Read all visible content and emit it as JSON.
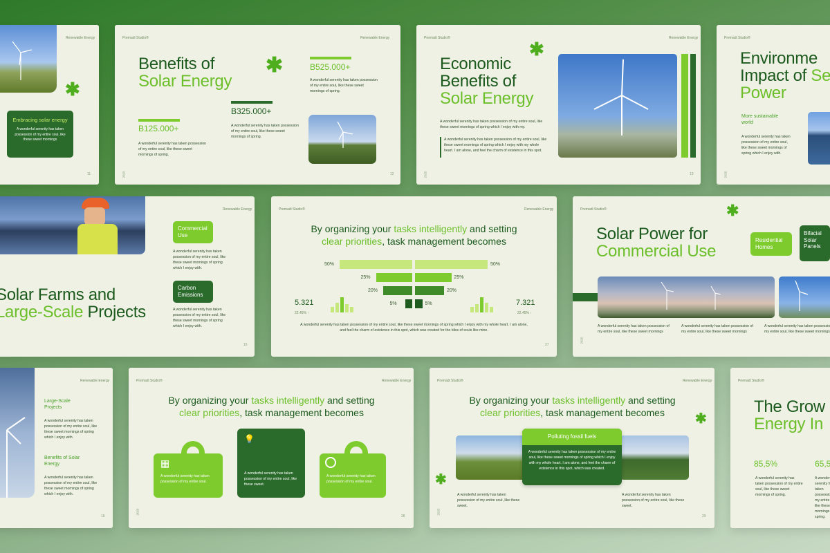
{
  "brand": "Premadi Studio®",
  "category": "Renewable Energy",
  "year": "2025",
  "lorem_short": "A wonderful serenity has taken possession of my entire soul, like these sweet mornings of spring.",
  "s11": {
    "box_title": "Embracing solar energy",
    "box_text": "A wonderful serenity has taken possession of my entire soul, like these sweet mornings",
    "page": "11"
  },
  "s12": {
    "title_a": "Benefits of",
    "title_b": "Solar Energy",
    "v1": "B525.000+",
    "v2": "B325.000+",
    "v3": "B125.000+",
    "t1": "A wonderful serenity has taken possession of my entire soul, like these sweet mornings of spring.",
    "t2": "A wonderful serenity has taken possession of my entire soul, like these sweet mornings of spring.",
    "t3": "A wonderful serenity has taken possession of my entire soul, like these sweet mornings of spring.",
    "page": "12"
  },
  "s13": {
    "title_a": "Economic",
    "title_b": "Benefits of",
    "title_c": "Solar Energy",
    "t1": "A wonderful serenity has taken possession of my entire soul, like these sweet mornings of spring which I enjoy with my.",
    "t2": "A wonderful serenity has taken possession of my entire soul, like these sweet mornings of spring which I enjoy with my whole heart. I am alone, and feel the charm of existence in this spot.",
    "page": "13"
  },
  "s14": {
    "title_a": "Environme",
    "title_b": "Impact of",
    "title_c": "Se",
    "title_d": "Power",
    "sub": "More sustainable world",
    "t1": "A wonderful serenity has taken possession of my entire soul, like these sweet mornings of spring which I enjoy with."
  },
  "s15": {
    "title_a": "Solar Farms and",
    "title_b": "Large-Scale",
    "title_c": "Projects",
    "b1": "Commercial Use",
    "b2": "Carbon Emissions",
    "t1": "A wonderful serenity has taken possession of my entire soul, like these sweet mornings of spring which I enjoy with.",
    "t2": "A wonderful serenity has taken possession of my entire soul, like these sweet mornings of spring which I enjoy with.",
    "page": "15"
  },
  "s27": {
    "h_a": "By organizing your",
    "h_b": "tasks intelligently",
    "h_c": "and setting",
    "h_d": "clear priorities",
    "h_e": ", task management becomes",
    "left_val": "5.321",
    "left_pct": "22.45% ↑",
    "right_val": "7.321",
    "right_pct": "22.45% ↑",
    "caption": "A wonderful serenity has taken possession of my entire soul, like these sweet mornings of spring which I enjoy with my whole heart. I am alone, and feel the charm of existence in this spot, which was created for the bliss of souls like mine.",
    "page": "27",
    "rows": [
      {
        "l": "50%",
        "r": "50%",
        "v": 50
      },
      {
        "l": "25%",
        "r": "25%",
        "v": 25
      },
      {
        "l": "20%",
        "r": "20%",
        "v": 20
      },
      {
        "l": "5%",
        "r": "5%",
        "v": 5
      }
    ]
  },
  "s28b": {
    "title_a": "Solar Power for",
    "title_b": "Commercial Use",
    "b1": "Residential Homes",
    "b2": "Bifacial Solar Panels",
    "t1": "A wonderful serenity has taken possession of my entire soul, like these sweet mornings",
    "t2": "A wonderful serenity has taken possession of my entire soul, like these sweet mornings",
    "t3": "A wonderful serenity has taken possession of my entire soul, like these sweet mornings"
  },
  "s16": {
    "i1": "Large-Scale Projects",
    "i2": "Benefits of Solar Energy",
    "t1": "A wonderful serenity has taken possession of my entire soul, like these sweet mornings of spring which I enjoy with.",
    "t2": "A wonderful serenity has taken possession of my entire soul, like these sweet mornings of spring which I enjoy with.",
    "page": "16"
  },
  "s28": {
    "h_a": "By organizing your",
    "h_b": "tasks intelligently",
    "h_c": "and setting",
    "h_d": "clear priorities",
    "h_e": ", task management becomes",
    "c1": "A wonderful serenity has taken possession of my entire soul.",
    "c2": "A wonderful serenity has taken possession of my entire soul, like these sweet.",
    "c3": "A wonderful serenity has taken possession of my entire soul.",
    "page": "28"
  },
  "s29": {
    "h_a": "By organizing your",
    "h_b": "tasks intelligently",
    "h_c": "and setting",
    "h_d": "clear priorities",
    "h_e": ", task management becomes",
    "card_title": "Polluting fossil fuels",
    "card_text": "A wonderful serenity has taken possession of my entire soul, like these sweet mornings of spring which I enjoy with my whole heart. I am alone, and feel the charm of existence in this spot, which was created.",
    "t1": "A wonderful serenity has taken possession of my entire soul, like these sweet.",
    "t2": "A wonderful serenity has taken possession of my entire soul, like these sweet.",
    "page": "29"
  },
  "s30": {
    "title_a": "The Grow",
    "title_b": "Energy In",
    "v1": "85,5%",
    "v2": "65,5",
    "t1": "A wonderful serenity has taken possession of my entire soul, like these sweet mornings of spring.",
    "t2": "A wonderful serenity has taken possession of my entire soul, like these sweet mornings of spring."
  },
  "colors": {
    "lime": "#7ecb2d",
    "dark": "#2a6b2b",
    "bg": "#eef1e3"
  }
}
